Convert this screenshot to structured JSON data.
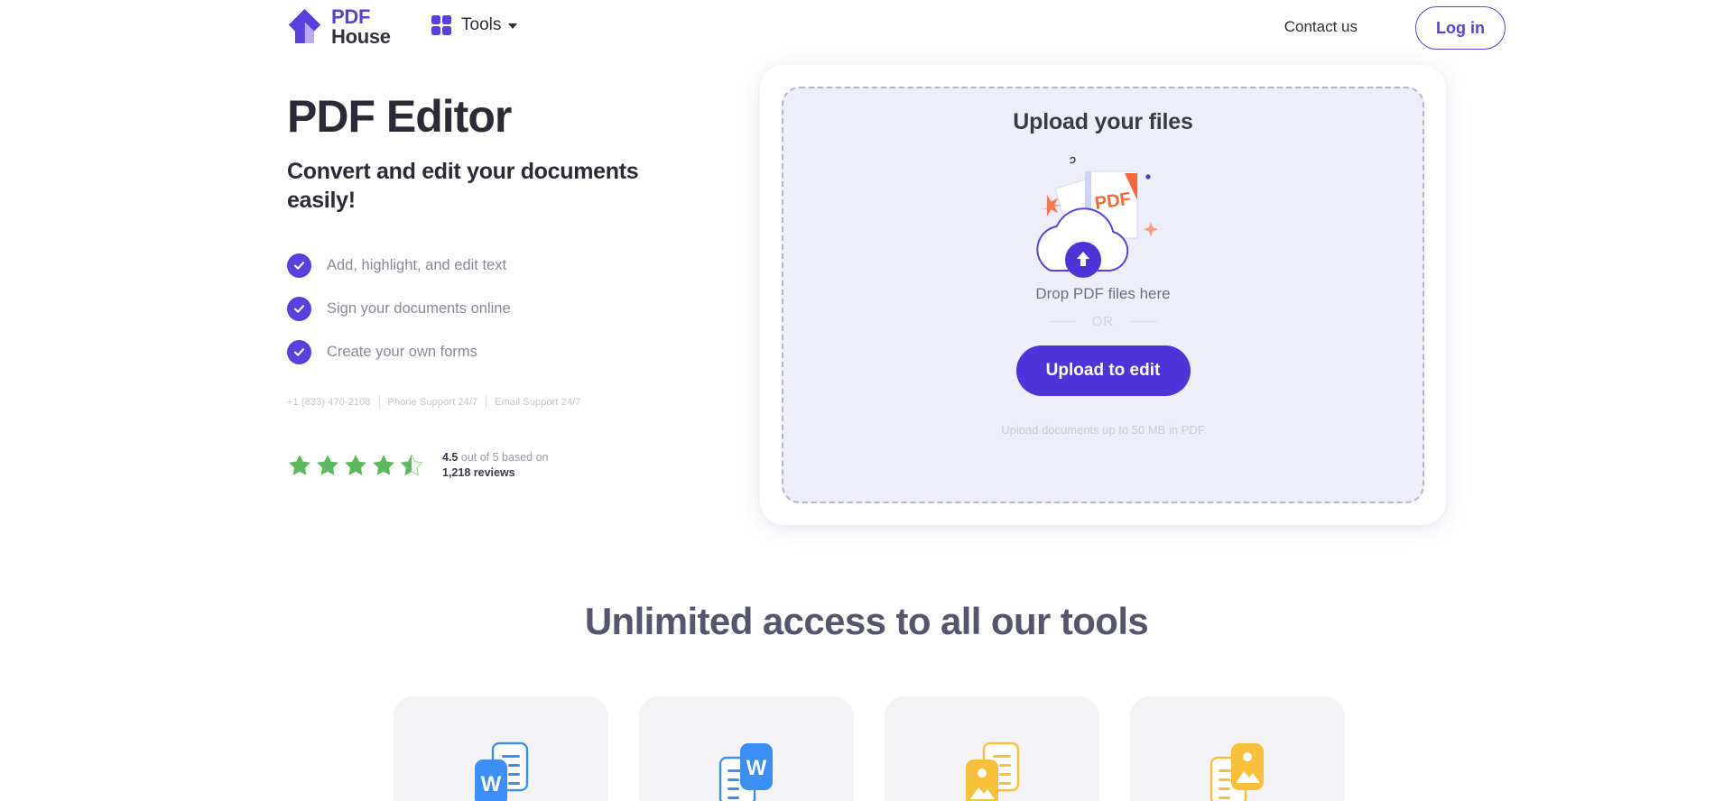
{
  "header": {
    "logo": {
      "line1": "PDF",
      "line2": "House",
      "icon": "house-logo-icon"
    },
    "tools_nav": {
      "label": "Tools",
      "icon": "grid-icon",
      "caret": "chevron-down-icon"
    },
    "contact_label": "Contact us",
    "login_label": "Log in"
  },
  "hero": {
    "title": "PDF Editor",
    "subtitle": "Convert and edit your documents easily!",
    "features": [
      {
        "label": "Add, highlight, and edit text",
        "icon": "check-circle-icon"
      },
      {
        "label": "Sign your documents online",
        "icon": "check-circle-icon"
      },
      {
        "label": "Create your own forms",
        "icon": "check-circle-icon"
      }
    ],
    "support": {
      "phone": "+1 (833) 470-2108",
      "phone_support": "Phone Support 24/7",
      "email_support": "Email Support 24/7"
    },
    "rating": {
      "score": "4.5",
      "stars_filled": 4.5,
      "stars_total": 5,
      "text_middle": " out of 5 based on",
      "count": "1,218 reviews",
      "star_color": "#5cb85f"
    }
  },
  "upload": {
    "heading": "Upload your files",
    "illustration": "pdf-cloud-upload-illustration",
    "drop_text": "Drop PDF files here",
    "or_label": "OR",
    "button_label": "Upload to edit",
    "limit_text": "Upload documents up to 50 MB in PDF"
  },
  "tools_section": {
    "title": "Unlimited access to all our tools",
    "cards": [
      {
        "icon": "word-to-pdf-icon",
        "color": "#3b8ef3"
      },
      {
        "icon": "pdf-to-word-icon",
        "color": "#3b8ef3"
      },
      {
        "icon": "jpg-to-pdf-icon",
        "color": "#f7bf3a"
      },
      {
        "icon": "pdf-to-jpg-icon",
        "color": "#f7bf3a"
      }
    ]
  },
  "colors": {
    "brand_purple": "#5a3fe0",
    "button_purple": "#4d33d8",
    "dropzone_bg": "#eeeefb",
    "card_gray": "#f3f3f5",
    "heading_dark": "#2b2b38",
    "muted_text": "#8a8a96"
  }
}
